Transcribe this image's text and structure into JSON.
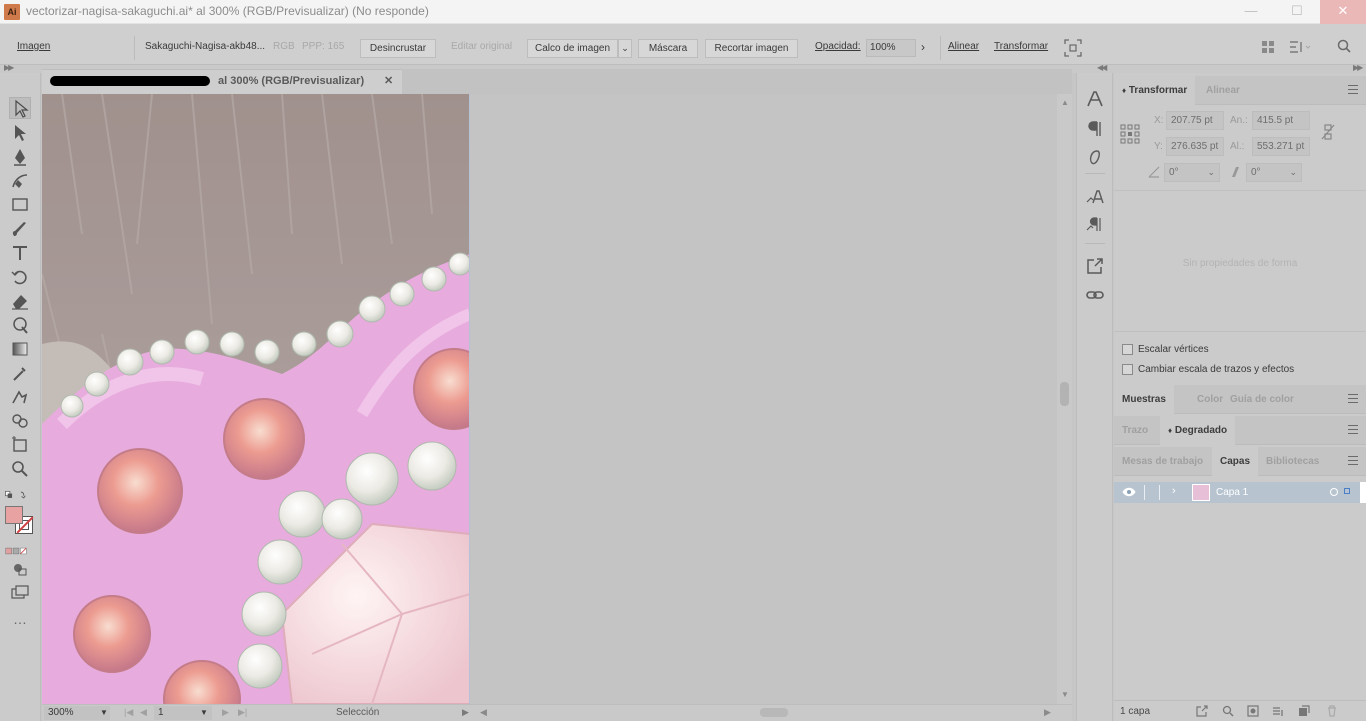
{
  "window": {
    "title": "vectorizar-nagisa-sakaguchi.ai* al 300% (RGB/Previsualizar)  (No responde)",
    "app_logo": "Ai",
    "minimize_glyph": "—",
    "maximize_glyph": "☐",
    "close_glyph": "✕"
  },
  "controlbar": {
    "section": "Imagen",
    "filename": "Sakaguchi-Nagisa-akb48...",
    "color_mode": "RGB",
    "ppp": "PPP: 165",
    "embed_button": "Desincrustar",
    "edit_original": "Editar original",
    "image_trace_button": "Calco de imagen",
    "mask_button": "Máscara",
    "crop_button": "Recortar imagen",
    "opacity_label": "Opacidad:",
    "opacity_value": "100%",
    "align_link": "Alinear",
    "transform_link": "Transformar"
  },
  "document_tab": {
    "title_suffix": "al  300% (RGB/Previsualizar)",
    "close_glyph": "✕"
  },
  "statusbar": {
    "zoom": "300%",
    "page": "1",
    "tool": "Selección"
  },
  "transform_panel": {
    "tabs": [
      "Transformar",
      "Alinear"
    ],
    "x_label": "X:",
    "x_value": "207.75 pt",
    "y_label": "Y:",
    "y_value": "276.635 pt",
    "width_label": "An.:",
    "width_value": "415.5 pt",
    "height_label": "Al.:",
    "height_value": "553.271 pt",
    "rotate_value": "0°",
    "shear_value": "0°",
    "no_shape_text": "Sin propiedades de forma",
    "scale_corners": "Escalar vértices",
    "scale_strokes": "Cambiar escala de trazos y efectos"
  },
  "swatches_panel": {
    "tabs": [
      "Muestras",
      "Color",
      "Guía de color"
    ]
  },
  "stroke_panel": {
    "tabs": [
      "Trazo",
      "Degradado"
    ]
  },
  "layers_panel": {
    "tabs": [
      "Mesas de trabajo",
      "Capas",
      "Bibliotecas"
    ],
    "layers": [
      {
        "name": "Capa 1"
      }
    ],
    "count": "1 capa"
  },
  "colors": {
    "accent_layer": "#b7c4d0",
    "fill_swatch": "#e8a2a2",
    "artwork_pink": "#e29ad6",
    "artwork_hair": "#8f7d79"
  }
}
